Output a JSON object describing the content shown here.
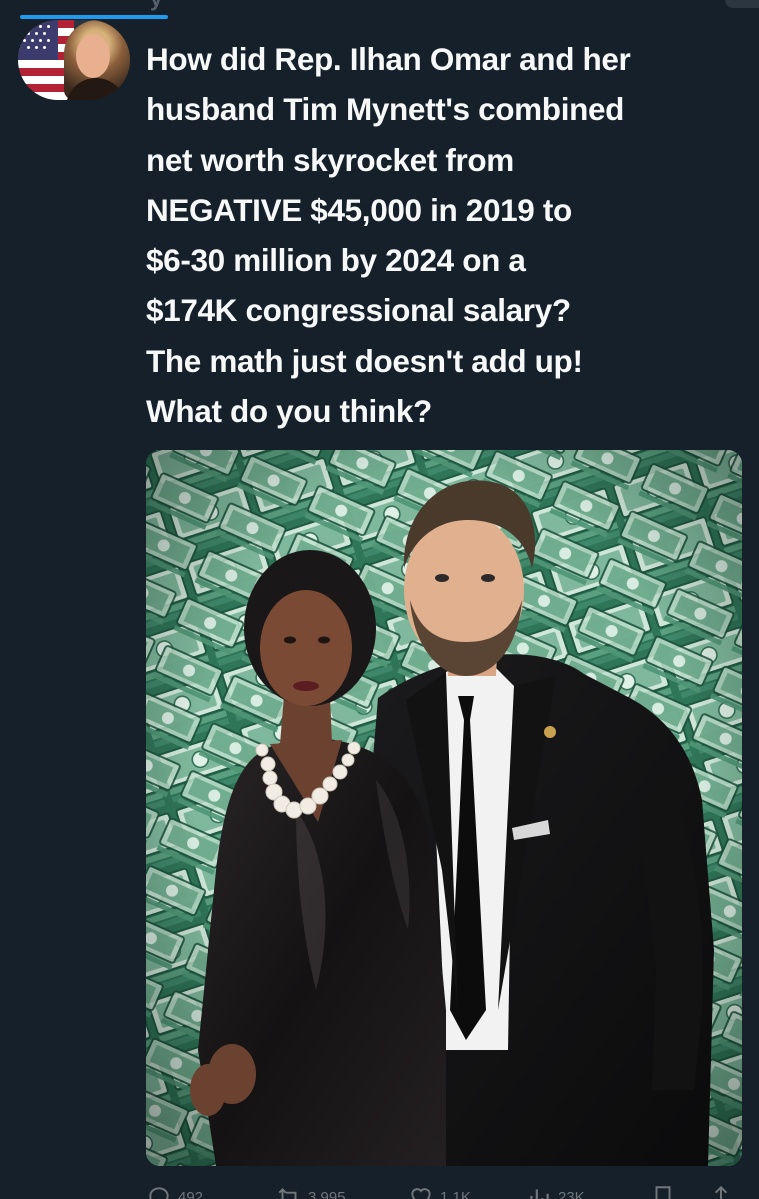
{
  "header": {
    "ghost_text": "y"
  },
  "tweet": {
    "text_lines": [
      "How did Rep. Ilhan Omar and her",
      "husband Tim Mynett's combined",
      "net worth skyrocket from",
      "NEGATIVE $45,000 in 2019 to",
      "$6-30 million by 2024 on a",
      "$174K congressional salary?",
      "The math just doesn't add up!",
      "What do you think?"
    ]
  },
  "actions": {
    "reply": {
      "icon": "reply-icon",
      "count": "492"
    },
    "repost": {
      "icon": "repost-icon",
      "count": "3,995"
    },
    "like": {
      "icon": "heart-icon",
      "count": "1.1K"
    },
    "views": {
      "icon": "views-icon",
      "count": "23K"
    },
    "bookmark": {
      "icon": "bookmark-icon"
    },
    "share": {
      "icon": "share-icon"
    }
  },
  "colors": {
    "background": "#15202b",
    "text": "#f7f9f9",
    "accent": "#1d9bf0",
    "muted": "#71767b",
    "money_green": "#3a8a6a"
  }
}
